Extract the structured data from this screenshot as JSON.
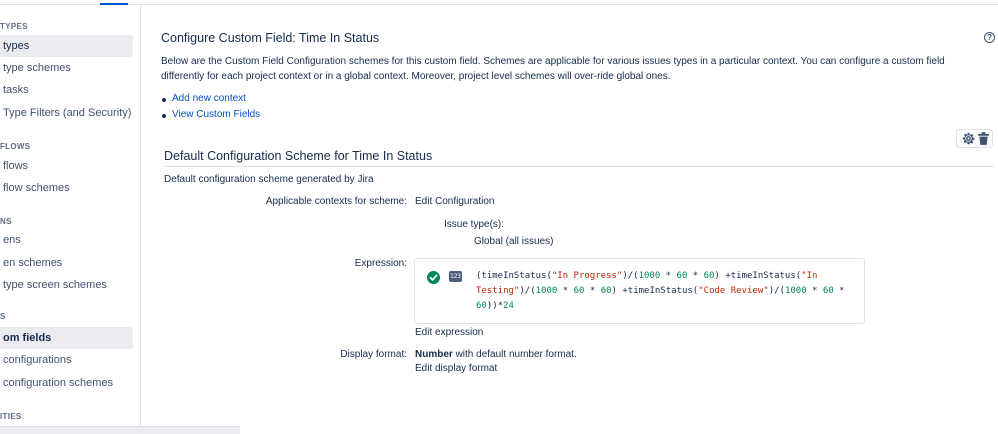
{
  "sidebar": {
    "sections": [
      {
        "heading": "TYPES",
        "items": [
          {
            "label": "types",
            "active": true
          },
          {
            "label": "type schemes"
          },
          {
            "label": "tasks"
          },
          {
            "label": "Type Filters (and Security)"
          }
        ]
      },
      {
        "heading": "FLOWS",
        "items": [
          {
            "label": "flows"
          },
          {
            "label": "flow schemes"
          }
        ]
      },
      {
        "heading": "NS",
        "items": [
          {
            "label": "ens"
          },
          {
            "label": "en schemes"
          },
          {
            "label": "type screen schemes"
          }
        ]
      },
      {
        "heading": "S",
        "items": [
          {
            "label": "om fields",
            "active": true
          },
          {
            "label": "configurations"
          },
          {
            "label": "configuration schemes"
          }
        ]
      },
      {
        "heading": "ITIES",
        "items": []
      }
    ]
  },
  "page": {
    "title": "Configure Custom Field: Time In Status",
    "description": "Below are the Custom Field Configuration schemes for this custom field. Schemes are applicable for various issues types in a particular context. You can configure a custom field differently for each project context or in a global context. Moreover, project level schemes will over-ride global ones.",
    "links": [
      "Add new context",
      "View Custom Fields"
    ],
    "help_icon": "question-circle-icon"
  },
  "scheme": {
    "title": "Default Configuration Scheme for Time In Status",
    "generated_text": "Default configuration scheme generated by Jira",
    "contexts_label": "Applicable contexts for scheme:",
    "edit_configuration": "Edit Configuration",
    "issue_types_label": "Issue type(s):",
    "issue_types_value": "Global (all issues)",
    "expression_label": "Expression:",
    "expression_icon_text": "123",
    "expression_parts": {
      "p1": "(timeInStatus(",
      "s1": "\"In Progress\"",
      "p2": ")/(",
      "n1": "1000",
      "p3": " * ",
      "n2": "60",
      "p4": " * ",
      "n3": "60",
      "p5": ") +timeInStatus(",
      "s2": "\"In Testing\"",
      "p6": ")/(",
      "n4": "1000",
      "p7": " * ",
      "n5": "60",
      "p8": " * ",
      "n6": "60",
      "p9": ") +timeInStatus(",
      "s3": "\"Code Review\"",
      "p10": ")/(",
      "n7": "1000",
      "p11": " * ",
      "n8": "60",
      "p12": " * ",
      "n9": "60",
      "p13": "))*",
      "n10": "24"
    },
    "edit_expression": "Edit expression",
    "display_format_label": "Display format:",
    "display_format_bold": "Number",
    "display_format_rest": " with default number format.",
    "edit_display_format": "Edit display format"
  },
  "colors": {
    "link": "#0052cc",
    "success": "#00875a",
    "string": "#bf2600",
    "text": "#172b4d"
  }
}
